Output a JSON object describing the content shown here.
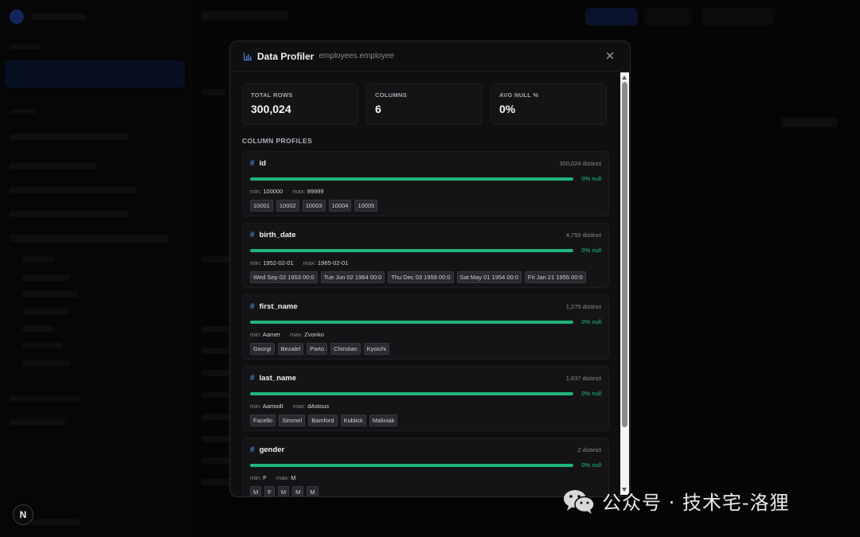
{
  "modal": {
    "title": "Data Profiler",
    "table": "employees.employee"
  },
  "stats": [
    {
      "label": "TOTAL ROWS",
      "value": "300,024"
    },
    {
      "label": "COLUMNS",
      "value": "6"
    },
    {
      "label": "AVG NULL %",
      "value": "0%"
    }
  ],
  "section_title": "COLUMN PROFILES",
  "columns": [
    {
      "name": "id",
      "distinct": "300,024 distinct",
      "null_label": "0% null",
      "non_null_fraction": 1.0,
      "min_label": "min:",
      "min": "100000",
      "max_label": "max:",
      "max": "99999",
      "samples": [
        "10001",
        "10002",
        "10003",
        "10004",
        "10005"
      ]
    },
    {
      "name": "birth_date",
      "distinct": "4,750 distinct",
      "null_label": "0% null",
      "non_null_fraction": 1.0,
      "min_label": "min:",
      "min": "1952-02-01",
      "max_label": "max:",
      "max": "1965-02-01",
      "samples": [
        "Wed Sep 02 1953 00:0",
        "Tue Jun 02 1964 00:0",
        "Thu Dec 03 1959 00:0",
        "Sat May 01 1954 00:0",
        "Fri Jan 21 1955 00:0"
      ]
    },
    {
      "name": "first_name",
      "distinct": "1,275 distinct",
      "null_label": "0% null",
      "non_null_fraction": 1.0,
      "min_label": "min:",
      "min": "Aamer",
      "max_label": "max:",
      "max": "Zvonko",
      "samples": [
        "Georgi",
        "Bezalel",
        "Parto",
        "Chirstian",
        "Kyoichi"
      ]
    },
    {
      "name": "last_name",
      "distinct": "1,637 distinct",
      "null_label": "0% null",
      "non_null_fraction": 1.0,
      "min_label": "min:",
      "min": "Aamodt",
      "max_label": "max:",
      "max": "dAstous",
      "samples": [
        "Facello",
        "Simmel",
        "Bamford",
        "Koblick",
        "Maliniak"
      ]
    },
    {
      "name": "gender",
      "distinct": "2 distinct",
      "null_label": "0% null",
      "non_null_fraction": 1.0,
      "min_label": "min:",
      "min": "F",
      "max_label": "max:",
      "max": "M",
      "samples": [
        "M",
        "F",
        "M",
        "M",
        "M"
      ]
    }
  ],
  "badge": "N",
  "watermark": "公众号 · 技术宅-洛狸",
  "colors": {
    "accent_green": "#1fb57a",
    "hash_blue": "#4f7fd6"
  }
}
